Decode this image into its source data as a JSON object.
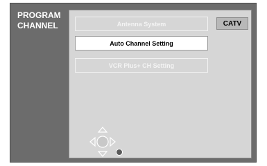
{
  "menu": {
    "title": "PROGRAM\nCHANNEL"
  },
  "settings": {
    "antenna_system": {
      "label": "Antenna System",
      "value": "CATV",
      "state": "disabled"
    },
    "auto_channel": {
      "label": "Auto Channel Setting",
      "state": "selected"
    },
    "vcr_plus": {
      "label": "VCR Plus+ CH Setting",
      "state": "disabled"
    }
  },
  "navigation": {
    "icons": [
      "dpad-icon",
      "ok-button-icon"
    ]
  }
}
